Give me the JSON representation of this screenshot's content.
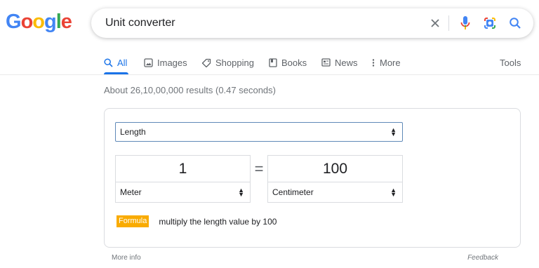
{
  "logo": {
    "letters": [
      "G",
      "o",
      "o",
      "g",
      "l",
      "e"
    ],
    "colors": {
      "blue": "#4285f4",
      "red": "#ea4335",
      "yellow": "#fbbc05",
      "green": "#34a853"
    }
  },
  "search": {
    "query": "Unit converter",
    "icons": [
      "close-icon",
      "microphone-icon",
      "camera-lens-icon",
      "search-icon"
    ]
  },
  "tabs": {
    "all": "All",
    "images": "Images",
    "shopping": "Shopping",
    "books": "Books",
    "news": "News",
    "more": "More",
    "tools": "Tools",
    "active": "All",
    "active_color": "#1a73e8"
  },
  "results": {
    "stats": "About 26,10,00,000 results (0.47 seconds)"
  },
  "converter": {
    "category": "Length",
    "from_value": "1",
    "from_unit": "Meter",
    "equals": "=",
    "to_value": "100",
    "to_unit": "Centimeter",
    "formula_label": "Formula",
    "formula_text": "multiply the length value by 100",
    "formula_badge_color": "#f9ab00"
  },
  "footer": {
    "more_info": "More info",
    "feedback": "Feedback"
  }
}
